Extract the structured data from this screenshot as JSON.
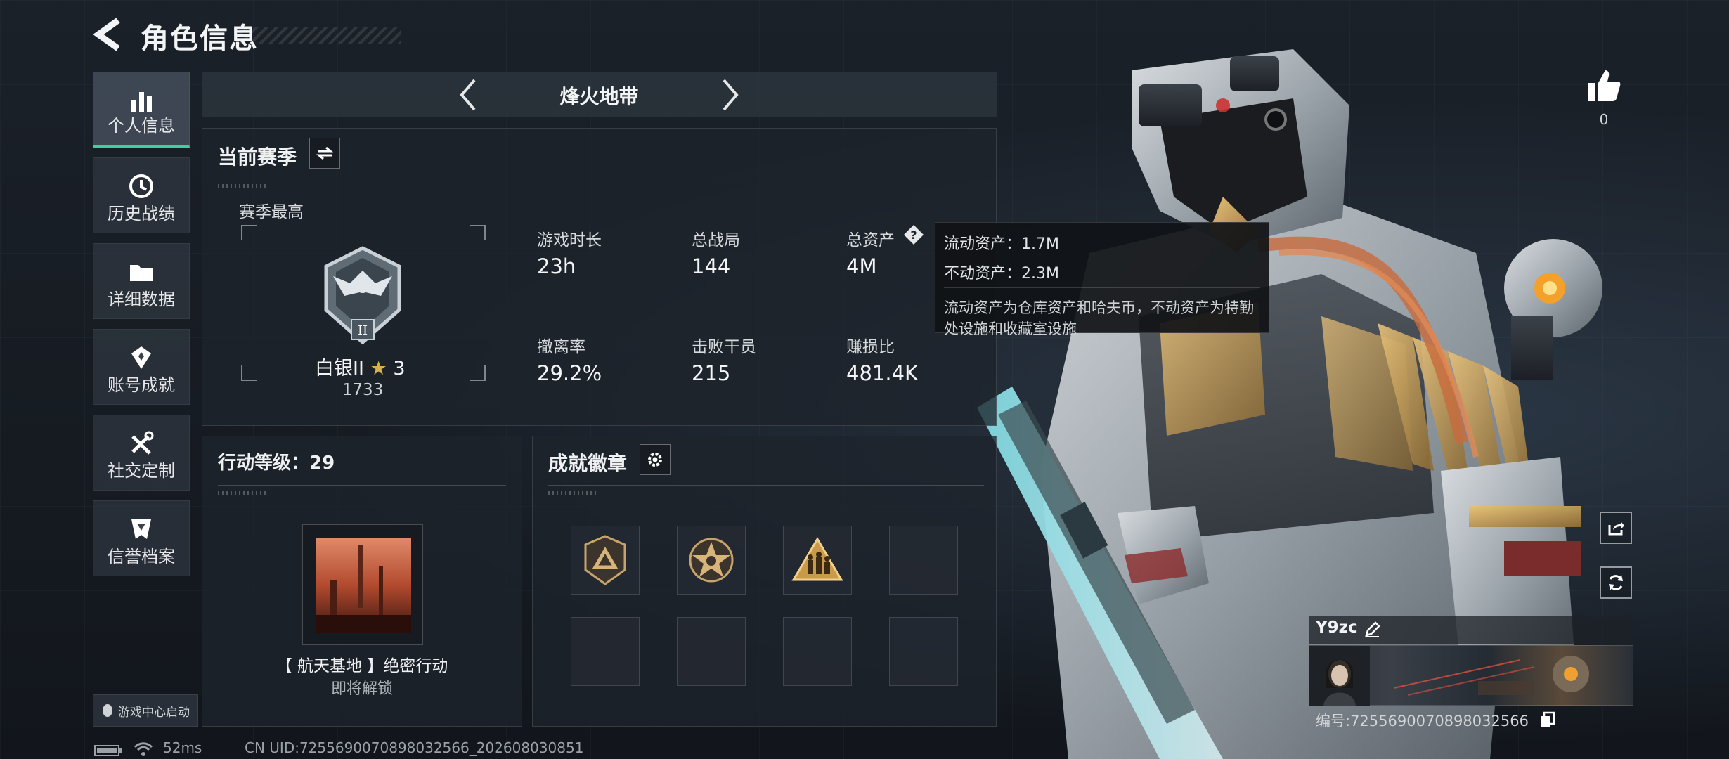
{
  "header": {
    "title": "角色信息"
  },
  "nav": {
    "items": [
      {
        "label": "个人信息",
        "icon": "bar-chart-icon",
        "active": true
      },
      {
        "label": "历史战绩",
        "icon": "history-clock-icon",
        "active": false
      },
      {
        "label": "详细数据",
        "icon": "folder-icon",
        "active": false
      },
      {
        "label": "账号成就",
        "icon": "achievement-medal-icon",
        "active": false
      },
      {
        "label": "社交定制",
        "icon": "tools-icon",
        "active": false
      },
      {
        "label": "信誉档案",
        "icon": "credit-shield-icon",
        "active": false
      }
    ],
    "game_center": "游戏中心启动"
  },
  "mode": {
    "title": "烽火地带"
  },
  "season": {
    "title": "当前赛季",
    "best_label": "赛季最高",
    "rank_name": "白银II",
    "rank_stars": "3",
    "rank_score": "1733",
    "rank_badge_numeral": "II",
    "stats": [
      {
        "label": "游戏时长",
        "value": "23h"
      },
      {
        "label": "总战局",
        "value": "144"
      },
      {
        "label": "总资产",
        "value": "4M"
      },
      {
        "label": "撤离率",
        "value": "29.2%"
      },
      {
        "label": "击败干员",
        "value": "215"
      },
      {
        "label": "赚损比",
        "value": "481.4K"
      }
    ]
  },
  "tooltip": {
    "liquid": "流动资产：1.7M",
    "fixed": "不动资产：2.3M",
    "note": "流动资产为仓库资产和哈夫币，不动资产为特勤处设施和收藏室设施"
  },
  "action_level": {
    "title": "行动等级：29",
    "mission_name": "【 航天基地 】绝密行动",
    "mission_status": "即将解锁"
  },
  "badges": {
    "title": "成就徽章",
    "filled": [
      "triangle-shield-badge",
      "star-skull-badge",
      "soldiers-triangle-badge"
    ],
    "empty_count": 5
  },
  "like": {
    "count": "0"
  },
  "profile": {
    "name": "Y9zc",
    "id": "编号:7255690070898032566"
  },
  "status_bar": {
    "ping": "52ms",
    "uid": "CN UID:7255690070898032566_202608030851"
  },
  "colors": {
    "accent": "#3fd0a0",
    "background": "#161b22",
    "panel": "#1e242c",
    "gold_star": "#d8b14a"
  }
}
